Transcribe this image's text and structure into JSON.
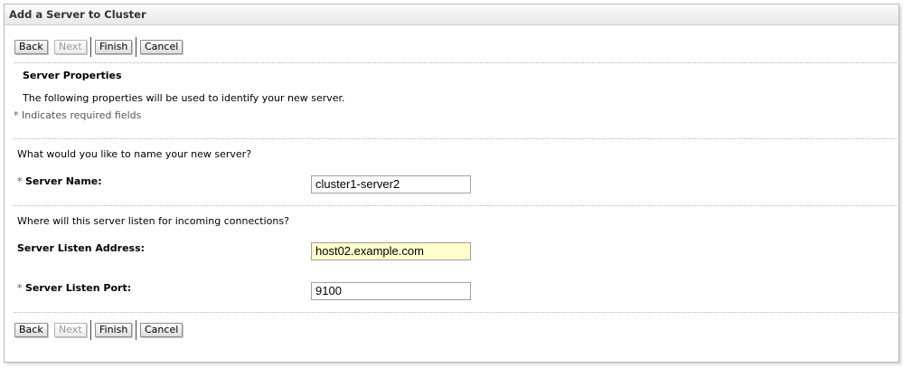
{
  "window": {
    "title": "Add a Server to Cluster"
  },
  "buttons": {
    "back": "Back",
    "next": "Next",
    "finish": "Finish",
    "cancel": "Cancel"
  },
  "section": {
    "title": "Server Properties",
    "description": "The following properties will be used to identify your new server.",
    "required_note": "* Indicates required fields"
  },
  "form": {
    "name_question": "What would you like to name your new server?",
    "server_name": {
      "required_mark": "*",
      "label": "Server Name:",
      "value": "cluster1-server2"
    },
    "listen_question": "Where will this server listen for incoming connections?",
    "listen_address": {
      "label": "Server Listen Address:",
      "value": "host02.example.com",
      "highlight_color": "#ffffcc"
    },
    "listen_port": {
      "required_mark": "*",
      "label": "Server Listen Port:",
      "value": "9100"
    }
  }
}
